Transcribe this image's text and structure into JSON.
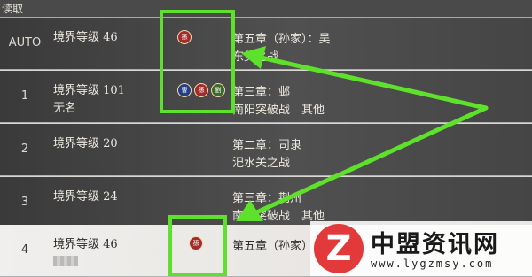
{
  "topbar": {
    "label": "读取"
  },
  "slots": [
    {
      "num": "AUTO",
      "level": "境界等级 46",
      "name": "",
      "chapter": "第五章（孙家）：吴",
      "stage": "东吴之战",
      "badges": [
        {
          "color": "#a22c2c",
          "glyph": "孫"
        }
      ]
    },
    {
      "num": "1",
      "level": "境界等级 101",
      "name": "无名",
      "chapter": "第三章：邺",
      "stage": "南阳突破战　其他",
      "badges": [
        {
          "color": "#233f86",
          "glyph": "曹"
        },
        {
          "color": "#a22c2c",
          "glyph": "孫"
        },
        {
          "color": "#3c6a2a",
          "glyph": "劉"
        }
      ]
    },
    {
      "num": "2",
      "level": "境界等级 20",
      "name": "",
      "chapter": "第二章：司隶",
      "stage": "汜水关之战",
      "badges": []
    },
    {
      "num": "3",
      "level": "境界等级 24",
      "name": "",
      "chapter": "第三章：荆州",
      "stage": "南阳突破战　其他",
      "badges": []
    },
    {
      "num": "4",
      "level": "境界等级 46",
      "name": "",
      "chapter": "第五章（孙家）",
      "stage": "",
      "badges": [
        {
          "color": "#a22c2c",
          "glyph": "孫"
        }
      ]
    }
  ],
  "watermark": {
    "logo": "Z",
    "title": "中盟资讯网",
    "url": "www.lygzmsy.com"
  },
  "colors": {
    "highlight": "#5ee12b",
    "badge_red": "#a22c2c",
    "badge_blue": "#233f86",
    "badge_green": "#3c6a2a"
  },
  "icons": [
    "faction-sun-icon",
    "faction-cao-icon",
    "faction-liu-icon",
    "arrow-annotation-icon"
  ]
}
